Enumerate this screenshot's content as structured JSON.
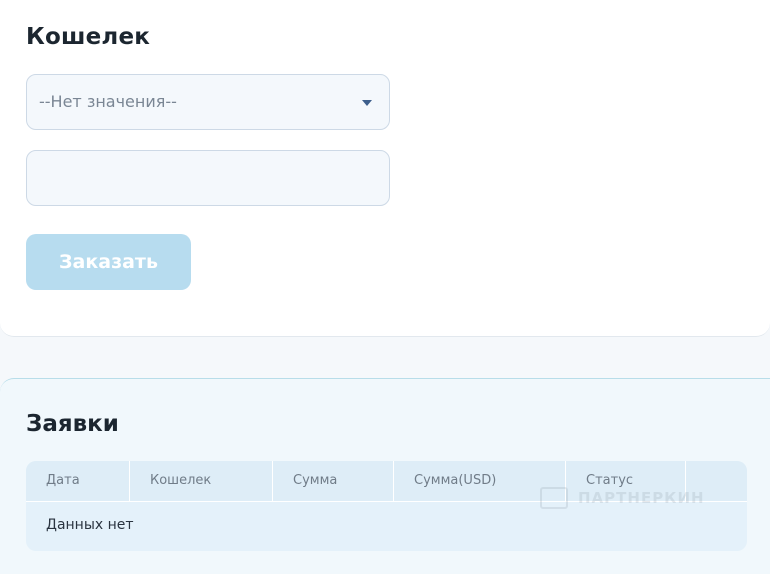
{
  "wallet": {
    "title": "Кошелек",
    "select": {
      "selected_value": "--Нет значения--"
    },
    "input": {
      "value": "",
      "placeholder": ""
    },
    "order_button_label": "Заказать"
  },
  "orders": {
    "title": "Заявки",
    "columns": [
      "Дата",
      "Кошелек",
      "Сумма",
      "Сумма(USD)",
      "Статус",
      ""
    ],
    "empty_text": "Данных нет"
  },
  "watermark": {
    "text": "ПАРТНЕРКИН"
  },
  "colors": {
    "button_bg": "#b7dcef",
    "panel_bg": "#f1f8fc",
    "field_bg": "#f4f8fc",
    "caret": "#3d5f8c"
  }
}
